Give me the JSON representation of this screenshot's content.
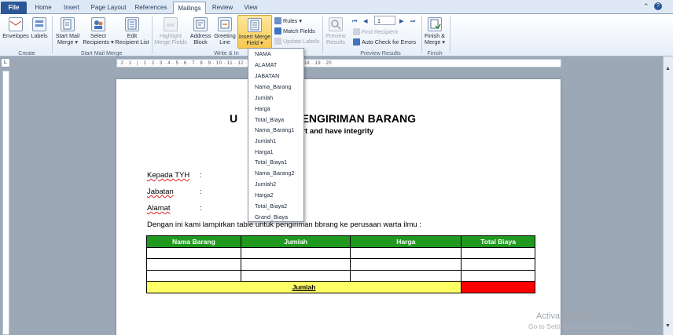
{
  "tabs": [
    "File",
    "Home",
    "Insert",
    "Page Layout",
    "References",
    "Mailings",
    "Review",
    "View"
  ],
  "ribbon": {
    "create": {
      "envelopes": "Envelopes",
      "labels": "Labels",
      "group": "Create"
    },
    "start": {
      "start_merge": "Start Mail Merge",
      "select_recipients": "Select Recipients",
      "edit_list": "Edit Recipient List",
      "group": "Start Mail Merge"
    },
    "write": {
      "highlight": "Highlight Merge Fields",
      "address": "Address Block",
      "greeting": "Greeting Line",
      "insert_field": "Insert Merge Field",
      "rules": "Rules",
      "match_fields": "Match Fields",
      "update_labels": "Update Labels",
      "group": "Write & In"
    },
    "preview": {
      "preview_results": "Preview Results",
      "record_number": "1",
      "find_recipient": "Find Recipient",
      "auto_check": "Auto Check for Errors",
      "group": "Preview Results"
    },
    "finish": {
      "finish_merge": "Finish & Merge",
      "group": "Finish"
    }
  },
  "ruler": {
    "text": "· 2 · 1 · | · 1 · 2 · 3 · 4 · 5 · 6 · 7 · 8 · 9 · 10 · 11 · 12 · 13 · 14 · 15 · 16 · 17 · 18 · 19 · 20"
  },
  "merge_fields": [
    "NAMA",
    "ALAMAT",
    "JABATAN",
    "Nama_Barang",
    "Jumlah",
    "Harga",
    "Total_Biaya",
    "Nama_Barang1",
    "Jumlah1",
    "Harga1",
    "Total_Biaya1",
    "Nama_Barang2",
    "Jumlah2",
    "Harga2",
    "Total_Biaya2",
    "Grand_Biaya"
  ],
  "document": {
    "title_left": "U",
    "title_right": "AN PENGIRIMAN BARANG",
    "subtitle": "MU – smart and have integrity",
    "fields": [
      {
        "label": "Kepada TYH",
        "colon": ":"
      },
      {
        "label": "Jabatan",
        "colon": ":"
      },
      {
        "label": "Alamat",
        "colon": ":"
      }
    ],
    "intro": "Dengan ini kami lampirkan table untuk pengiriman bbrang ke perusaan warta ilmu :",
    "table": {
      "headers": [
        "Nama Barang",
        "Jumlah",
        "Harga",
        "Total Biaya"
      ],
      "rows": 3,
      "sum_label": "Jumlah"
    }
  },
  "watermark": {
    "line1": "Activate Windows",
    "line2": "Go to Settings to activate Windows."
  },
  "colors": {
    "header_green": "#1f9a1f",
    "sum_yellow": "#ffff66",
    "sum_red": "#ff0000",
    "file_tab": "#2b5797"
  }
}
